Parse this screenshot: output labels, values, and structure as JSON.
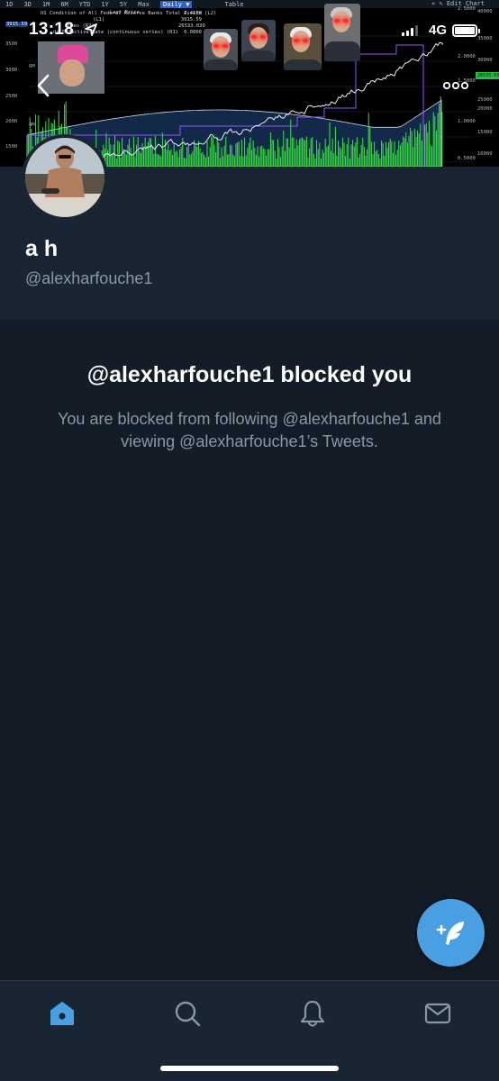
{
  "status_bar": {
    "time": "13:18",
    "network": "4G",
    "signal_bars": 3,
    "battery_level": 1.0
  },
  "banner": {
    "timeframes": [
      "1D",
      "3D",
      "1M",
      "6M",
      "YTD",
      "1Y",
      "5Y",
      "Max"
    ],
    "interval": "Daily ▼",
    "table_label": "Table",
    "edit_chart_label": "« ✎ Edit Chart",
    "last_price_label": "Last Price",
    "legend_lines": [
      "US Condition of All Federal Reserve Banks Total Assets (L2)",
      "(L1)",
      "imes (R2)",
      "ds Effective Rate (continuous series) (R1)"
    ],
    "legend_values": [
      "7.413M",
      "3915.59",
      "26533.030",
      "0.0800"
    ],
    "left_axis_labels": [
      "3500",
      "3000",
      "2500",
      "2000",
      "1500",
      "6M",
      "4M"
    ],
    "right_axis_labels": [
      "40000",
      "35000",
      "30000",
      "25000",
      "20000",
      "15000",
      "10000",
      "2.5000",
      "2.0000",
      "1.5000",
      "1.0000",
      "0.5000"
    ],
    "price_tag": "26533.030",
    "left_value_tag": "3915.59"
  },
  "profile": {
    "display_name": "a h",
    "handle": "@alexharfouche1"
  },
  "blocked": {
    "title": "@alexharfouche1 blocked you",
    "body": "You are blocked from following @alexharfouche1 and viewing @alexharfouche1’s Tweets."
  },
  "icons": {
    "back": "chevron-left-icon",
    "more": "more-horizontal-icon",
    "compose": "compose-tweet-icon",
    "home": "home-icon",
    "search": "search-icon",
    "notifications": "bell-icon",
    "messages": "mail-icon"
  },
  "colors": {
    "background": "#141c27",
    "header_background": "#1a2533",
    "accent": "#4a9fe3",
    "secondary_text": "#8898a6",
    "chart_volume": "#3dff3d"
  }
}
